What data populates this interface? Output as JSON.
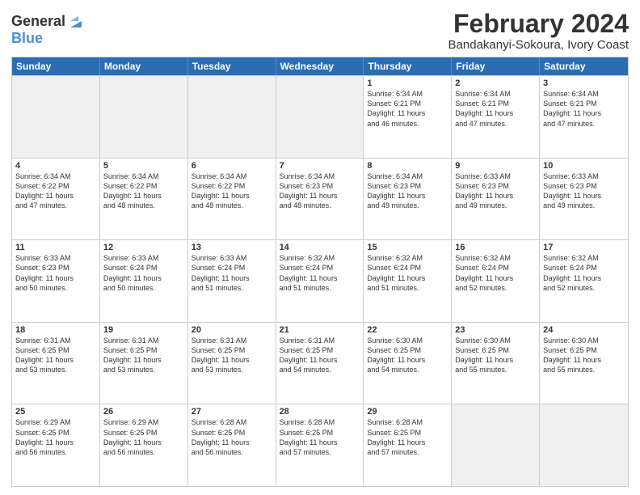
{
  "logo": {
    "line1": "General",
    "line2": "Blue"
  },
  "title": "February 2024",
  "subtitle": "Bandakanyi-Sokoura, Ivory Coast",
  "header_days": [
    "Sunday",
    "Monday",
    "Tuesday",
    "Wednesday",
    "Thursday",
    "Friday",
    "Saturday"
  ],
  "rows": [
    [
      {
        "day": "",
        "info": "",
        "shaded": true
      },
      {
        "day": "",
        "info": "",
        "shaded": true
      },
      {
        "day": "",
        "info": "",
        "shaded": true
      },
      {
        "day": "",
        "info": "",
        "shaded": true
      },
      {
        "day": "1",
        "info": "Sunrise: 6:34 AM\nSunset: 6:21 PM\nDaylight: 11 hours\nand 46 minutes."
      },
      {
        "day": "2",
        "info": "Sunrise: 6:34 AM\nSunset: 6:21 PM\nDaylight: 11 hours\nand 47 minutes."
      },
      {
        "day": "3",
        "info": "Sunrise: 6:34 AM\nSunset: 6:21 PM\nDaylight: 11 hours\nand 47 minutes."
      }
    ],
    [
      {
        "day": "4",
        "info": "Sunrise: 6:34 AM\nSunset: 6:22 PM\nDaylight: 11 hours\nand 47 minutes."
      },
      {
        "day": "5",
        "info": "Sunrise: 6:34 AM\nSunset: 6:22 PM\nDaylight: 11 hours\nand 48 minutes."
      },
      {
        "day": "6",
        "info": "Sunrise: 6:34 AM\nSunset: 6:22 PM\nDaylight: 11 hours\nand 48 minutes."
      },
      {
        "day": "7",
        "info": "Sunrise: 6:34 AM\nSunset: 6:23 PM\nDaylight: 11 hours\nand 48 minutes."
      },
      {
        "day": "8",
        "info": "Sunrise: 6:34 AM\nSunset: 6:23 PM\nDaylight: 11 hours\nand 49 minutes."
      },
      {
        "day": "9",
        "info": "Sunrise: 6:33 AM\nSunset: 6:23 PM\nDaylight: 11 hours\nand 49 minutes."
      },
      {
        "day": "10",
        "info": "Sunrise: 6:33 AM\nSunset: 6:23 PM\nDaylight: 11 hours\nand 49 minutes."
      }
    ],
    [
      {
        "day": "11",
        "info": "Sunrise: 6:33 AM\nSunset: 6:23 PM\nDaylight: 11 hours\nand 50 minutes."
      },
      {
        "day": "12",
        "info": "Sunrise: 6:33 AM\nSunset: 6:24 PM\nDaylight: 11 hours\nand 50 minutes."
      },
      {
        "day": "13",
        "info": "Sunrise: 6:33 AM\nSunset: 6:24 PM\nDaylight: 11 hours\nand 51 minutes."
      },
      {
        "day": "14",
        "info": "Sunrise: 6:32 AM\nSunset: 6:24 PM\nDaylight: 11 hours\nand 51 minutes."
      },
      {
        "day": "15",
        "info": "Sunrise: 6:32 AM\nSunset: 6:24 PM\nDaylight: 11 hours\nand 51 minutes."
      },
      {
        "day": "16",
        "info": "Sunrise: 6:32 AM\nSunset: 6:24 PM\nDaylight: 11 hours\nand 52 minutes."
      },
      {
        "day": "17",
        "info": "Sunrise: 6:32 AM\nSunset: 6:24 PM\nDaylight: 11 hours\nand 52 minutes."
      }
    ],
    [
      {
        "day": "18",
        "info": "Sunrise: 6:31 AM\nSunset: 6:25 PM\nDaylight: 11 hours\nand 53 minutes."
      },
      {
        "day": "19",
        "info": "Sunrise: 6:31 AM\nSunset: 6:25 PM\nDaylight: 11 hours\nand 53 minutes."
      },
      {
        "day": "20",
        "info": "Sunrise: 6:31 AM\nSunset: 6:25 PM\nDaylight: 11 hours\nand 53 minutes."
      },
      {
        "day": "21",
        "info": "Sunrise: 6:31 AM\nSunset: 6:25 PM\nDaylight: 11 hours\nand 54 minutes."
      },
      {
        "day": "22",
        "info": "Sunrise: 6:30 AM\nSunset: 6:25 PM\nDaylight: 11 hours\nand 54 minutes."
      },
      {
        "day": "23",
        "info": "Sunrise: 6:30 AM\nSunset: 6:25 PM\nDaylight: 11 hours\nand 55 minutes."
      },
      {
        "day": "24",
        "info": "Sunrise: 6:30 AM\nSunset: 6:25 PM\nDaylight: 11 hours\nand 55 minutes."
      }
    ],
    [
      {
        "day": "25",
        "info": "Sunrise: 6:29 AM\nSunset: 6:25 PM\nDaylight: 11 hours\nand 56 minutes."
      },
      {
        "day": "26",
        "info": "Sunrise: 6:29 AM\nSunset: 6:25 PM\nDaylight: 11 hours\nand 56 minutes."
      },
      {
        "day": "27",
        "info": "Sunrise: 6:28 AM\nSunset: 6:25 PM\nDaylight: 11 hours\nand 56 minutes."
      },
      {
        "day": "28",
        "info": "Sunrise: 6:28 AM\nSunset: 6:25 PM\nDaylight: 11 hours\nand 57 minutes."
      },
      {
        "day": "29",
        "info": "Sunrise: 6:28 AM\nSunset: 6:25 PM\nDaylight: 11 hours\nand 57 minutes."
      },
      {
        "day": "",
        "info": "",
        "shaded": true
      },
      {
        "day": "",
        "info": "",
        "shaded": true
      }
    ]
  ]
}
